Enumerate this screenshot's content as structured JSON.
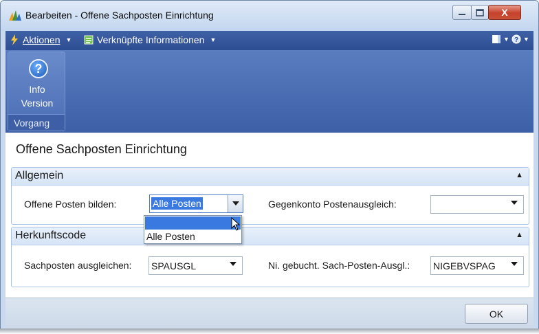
{
  "window": {
    "title": "Bearbeiten - Offene Sachposten Einrichtung",
    "close_glyph": "X"
  },
  "actionbar": {
    "actions_label": "Aktionen",
    "related_info_label": "Verknüpfte Informationen"
  },
  "ribbon": {
    "help_glyph": "?",
    "info_label": "Info",
    "version_label": "Version",
    "group_label": "Vorgang"
  },
  "page": {
    "title": "Offene Sachposten Einrichtung"
  },
  "general": {
    "header": "Allgemein",
    "open_entries_label": "Offene Posten bilden:",
    "open_entries_value": "Alle Posten",
    "dropdown_options": [
      "",
      "Alle Posten"
    ],
    "contra_account_label": "Gegenkonto Postenausgleich:",
    "contra_account_value": ""
  },
  "source_code": {
    "header": "Herkunftscode",
    "apply_gl_label": "Sachposten ausgleichen:",
    "apply_gl_value": "SPAUSGL",
    "unposted_label": "Ni. gebucht. Sach-Posten-Ausgl.:",
    "unposted_value": "NIGEBVSPAG"
  },
  "footer": {
    "ok_label": "OK"
  }
}
